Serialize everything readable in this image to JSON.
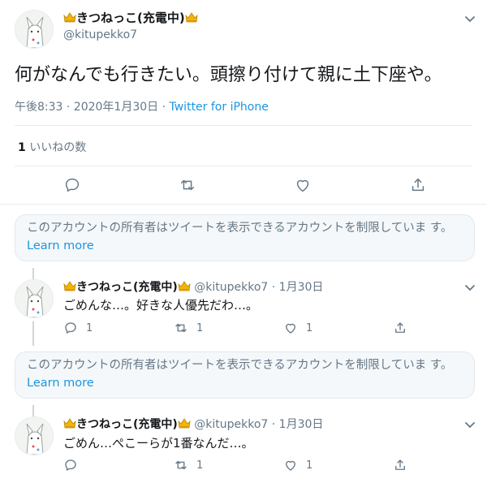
{
  "main_tweet": {
    "display_name": "きつねっこ(充電中)",
    "handle": "@kitupekko7",
    "text": "何がなんでも行きたい。頭擦り付けて親に土下座や。",
    "timestamp": "午後8:33 · 2020年1月30日 · ",
    "source": "Twitter for iPhone",
    "likes_count": "1",
    "likes_label": "いいねの数"
  },
  "notice": {
    "text": "このアカウントの所有者はツイートを表示できるアカウントを制限していま す。",
    "link": "Learn more"
  },
  "replies": [
    {
      "display_name": "きつねっこ(充電中)",
      "handle": "@kitupekko7",
      "date": "· 1月30日",
      "text": "ごめんな…。好きな人優先だわ…。",
      "reply_count": "1",
      "retweet_count": "1",
      "like_count": "1"
    },
    {
      "display_name": "きつねっこ(充電中)",
      "handle": "@kitupekko7",
      "date": "· 1月30日",
      "text": "ごめん…ぺこーらが1番なんだ…。",
      "reply_count": "",
      "retweet_count": "1",
      "like_count": "1"
    }
  ],
  "icons": [
    "avatar",
    "crown-icon",
    "chevron-down-icon",
    "reply-icon",
    "retweet-icon",
    "like-icon",
    "share-icon"
  ],
  "colors": {
    "link": "#1b95e0",
    "muted": "#657786",
    "crown": "#f4b400",
    "divider": "#e6ecf0"
  }
}
